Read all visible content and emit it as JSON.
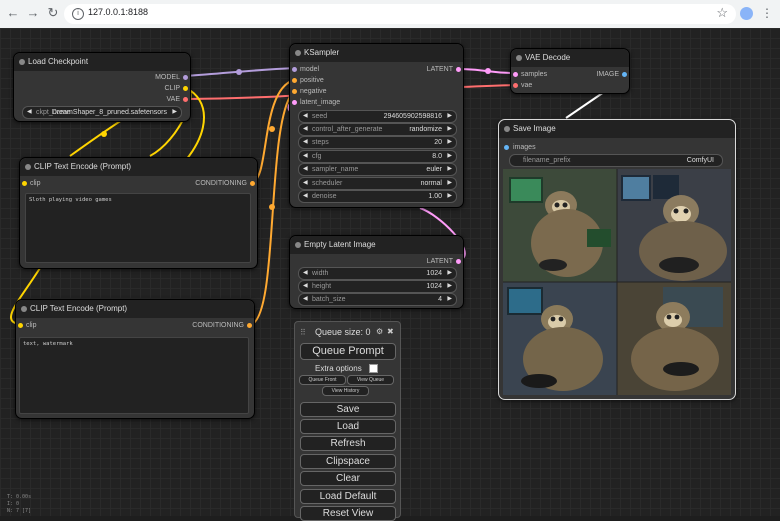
{
  "browser": {
    "url": "127.0.0.1:8188",
    "back_icon": "←",
    "forward_icon": "→",
    "reload_icon": "↻",
    "menu_icon": "⋮",
    "star_icon": "☆"
  },
  "colors": {
    "model_link": "#b39ddb",
    "clip_link": "#ffd500",
    "vae_link": "#ff6e6e",
    "latent_link": "#ff9cf9",
    "conditioning_link": "#ffa931",
    "image_link": "#64b5f6"
  },
  "nodes": {
    "load_checkpoint": {
      "title": "Load Checkpoint",
      "outputs": [
        "MODEL",
        "CLIP",
        "VAE"
      ],
      "ckpt_label": "ckpt_name",
      "ckpt_value": "DreamShaper_8_pruned.safetensors"
    },
    "clip_pos": {
      "title": "CLIP Text Encode (Prompt)",
      "input": "clip",
      "output": "CONDITIONING",
      "text": "Sloth playing video games"
    },
    "clip_neg": {
      "title": "CLIP Text Encode (Prompt)",
      "input": "clip",
      "output": "CONDITIONING",
      "text": "text, watermark"
    },
    "ksampler": {
      "title": "KSampler",
      "inputs": [
        "model",
        "positive",
        "negative",
        "latent_image"
      ],
      "output": "LATENT",
      "widgets": [
        {
          "label": "seed",
          "value": "294605902598816"
        },
        {
          "label": "control_after_generate",
          "value": "randomize"
        },
        {
          "label": "steps",
          "value": "20"
        },
        {
          "label": "cfg",
          "value": "8.0"
        },
        {
          "label": "sampler_name",
          "value": "euler"
        },
        {
          "label": "scheduler",
          "value": "normal"
        },
        {
          "label": "denoise",
          "value": "1.00"
        }
      ]
    },
    "vae_decode": {
      "title": "VAE Decode",
      "inputs": [
        "samples",
        "vae"
      ],
      "output": "IMAGE"
    },
    "empty_latent": {
      "title": "Empty Latent Image",
      "output": "LATENT",
      "widgets": [
        {
          "label": "width",
          "value": "1024"
        },
        {
          "label": "height",
          "value": "1024"
        },
        {
          "label": "batch_size",
          "value": "4"
        }
      ]
    },
    "save_image": {
      "title": "Save Image",
      "input": "images",
      "prefix_label": "filename_prefix",
      "prefix_value": "ComfyUI"
    }
  },
  "queue_panel": {
    "queue_size_label": "Queue size: 0",
    "gear_icon": "⚙",
    "close_icon": "✖",
    "queue_prompt": "Queue Prompt",
    "extra_options": "Extra options",
    "queue_front": "Queue Front",
    "view_queue": "View Queue",
    "view_history": "View History",
    "buttons": [
      "Save",
      "Load",
      "Refresh",
      "Clipspace",
      "Clear",
      "Load Default",
      "Reset View"
    ]
  },
  "hud": {
    "line1": "T: 0.00s",
    "line2": "I: 0",
    "line3": "N: 7 [7]"
  }
}
